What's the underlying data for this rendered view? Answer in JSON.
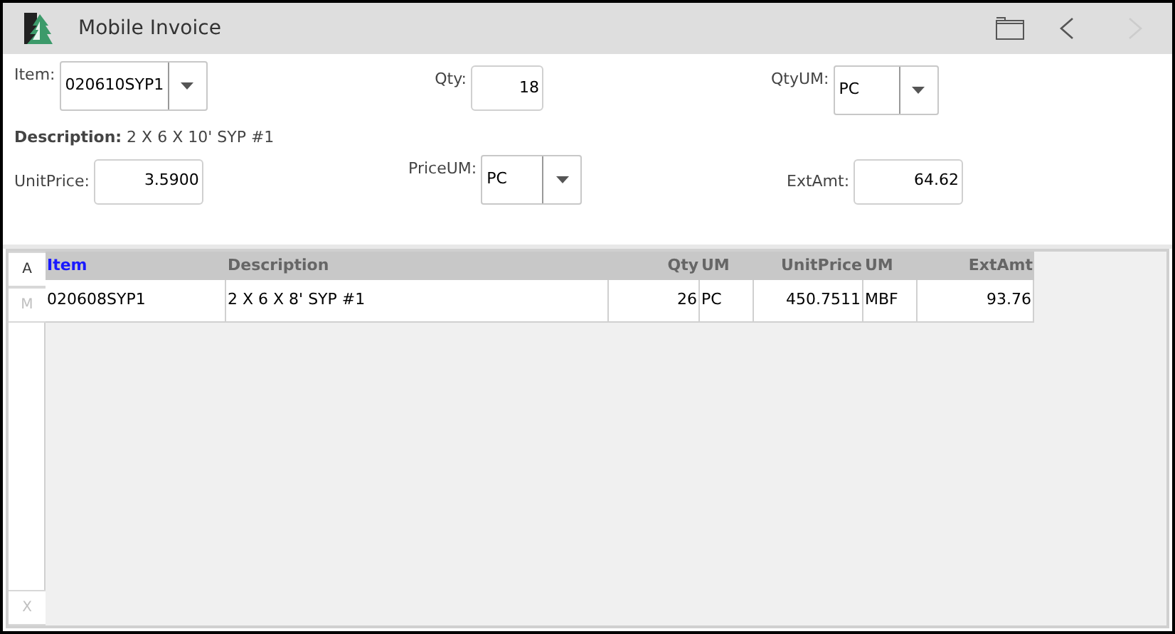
{
  "window": {
    "title": "Mobile Invoice",
    "nav": [
      {
        "kind": "back",
        "disabled": false
      },
      {
        "kind": "forward",
        "disabled": true
      }
    ]
  },
  "form": {
    "item": {
      "label": "Item:",
      "value": "020610SYP1"
    },
    "qty": {
      "label": "Qty:",
      "value": "18"
    },
    "qty_um": {
      "label": "QtyUM:",
      "value": "PC"
    },
    "description": {
      "label": "Description:",
      "value": "2 X 6 X 10' SYP #1"
    },
    "unit_price": {
      "label": "UnitPrice:",
      "value": "3.5900"
    },
    "price_um": {
      "label": "PriceUM:",
      "value": "PC"
    },
    "ext_amt": {
      "label": "ExtAmt:",
      "value": "64.62"
    }
  },
  "side_buttons": [
    {
      "label": "A",
      "disabled": false
    },
    {
      "label": "M",
      "disabled": true
    },
    {
      "label": "X",
      "disabled": true
    }
  ],
  "table": {
    "columns": [
      {
        "label": "Item",
        "selected": true,
        "kind": "text"
      },
      {
        "label": "Description",
        "selected": false,
        "kind": "text"
      },
      {
        "label": "Qty",
        "selected": false,
        "kind": "number"
      },
      {
        "label": "UM",
        "selected": false,
        "kind": "text"
      },
      {
        "label": "UnitPrice",
        "selected": false,
        "kind": "number"
      },
      {
        "label": "UM",
        "selected": false,
        "kind": "text"
      },
      {
        "label": "ExtAmt",
        "selected": false,
        "kind": "number"
      }
    ],
    "rows": [
      [
        "020608SYP1",
        "2 X 6 X 8' SYP #1",
        "26",
        "PC",
        "450.7511",
        "MBF",
        "93.76"
      ]
    ]
  }
}
